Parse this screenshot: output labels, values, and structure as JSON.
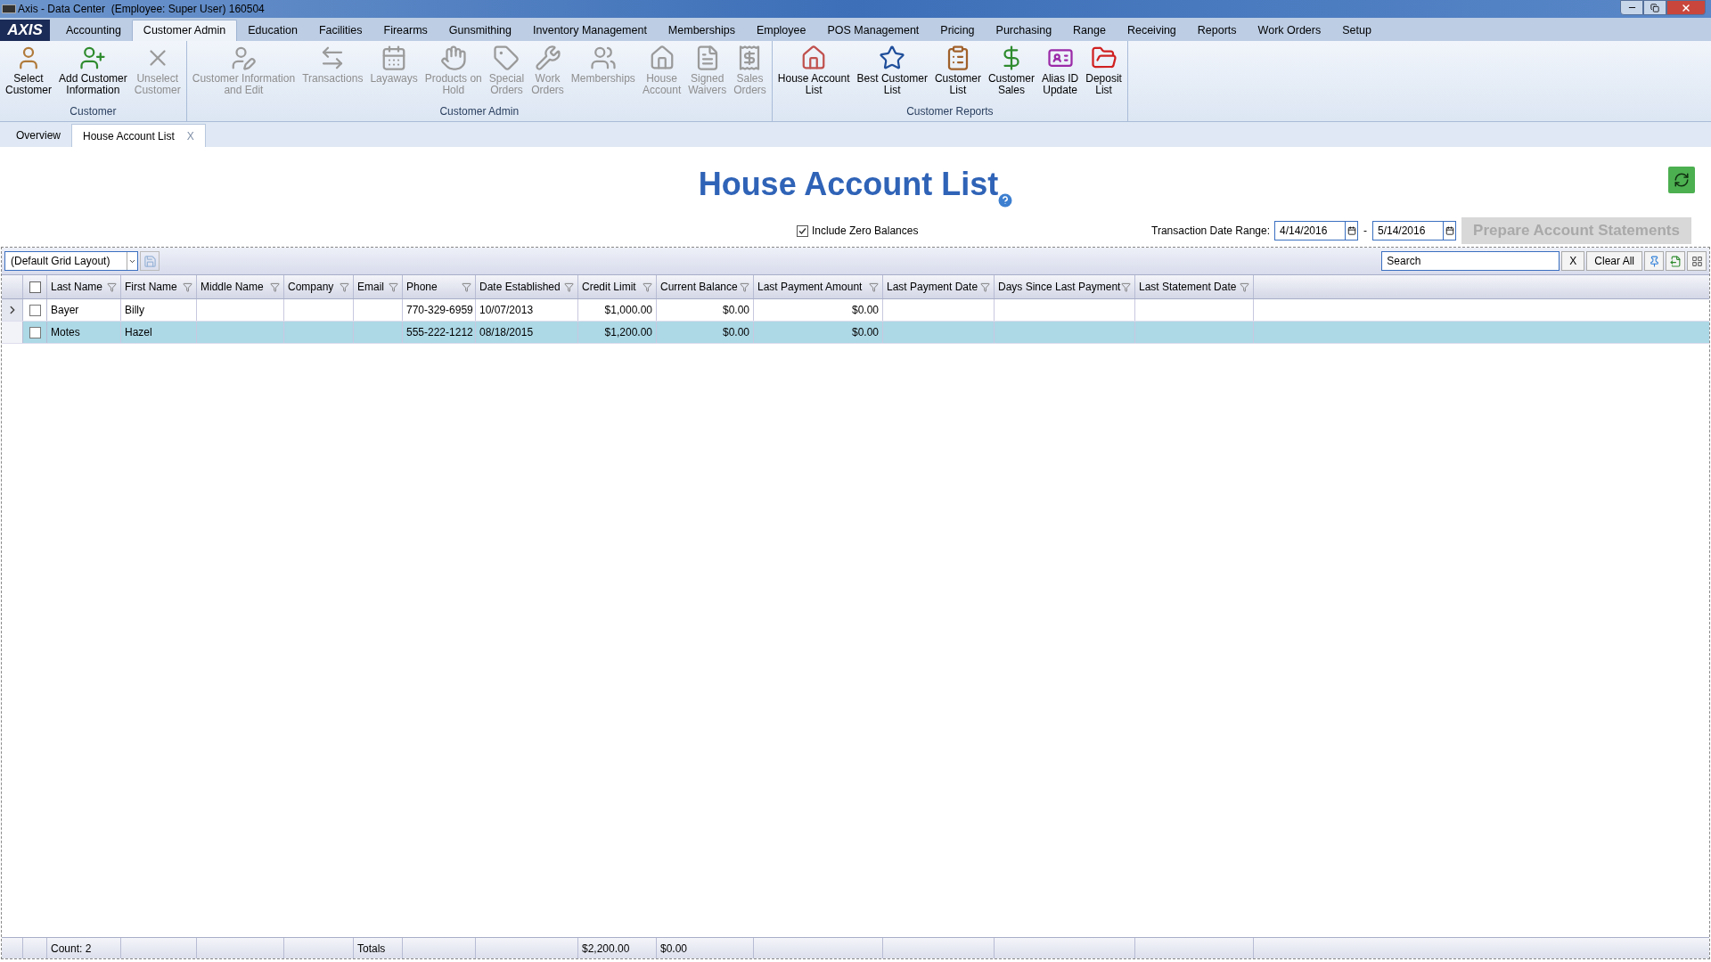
{
  "window": {
    "title": "Axis - Data Center  (Employee: Super User) 160504"
  },
  "logo": "AXIS",
  "menu_tabs": [
    {
      "label": "Accounting",
      "selected": false
    },
    {
      "label": "Customer Admin",
      "selected": true
    },
    {
      "label": "Education",
      "selected": false
    },
    {
      "label": "Facilities",
      "selected": false
    },
    {
      "label": "Firearms",
      "selected": false
    },
    {
      "label": "Gunsmithing",
      "selected": false
    },
    {
      "label": "Inventory Management",
      "selected": false
    },
    {
      "label": "Memberships",
      "selected": false
    },
    {
      "label": "Employee",
      "selected": false
    },
    {
      "label": "POS Management",
      "selected": false
    },
    {
      "label": "Pricing",
      "selected": false
    },
    {
      "label": "Purchasing",
      "selected": false
    },
    {
      "label": "Range",
      "selected": false
    },
    {
      "label": "Receiving",
      "selected": false
    },
    {
      "label": "Reports",
      "selected": false
    },
    {
      "label": "Work Orders",
      "selected": false
    },
    {
      "label": "Setup",
      "selected": false
    }
  ],
  "ribbon_groups": [
    {
      "label": "Customer",
      "items": [
        {
          "label": "Select\nCustomer",
          "disabled": false
        },
        {
          "label": "Add Customer\nInformation",
          "disabled": false
        },
        {
          "label": "Unselect\nCustomer",
          "disabled": true
        }
      ]
    },
    {
      "label": "Customer Admin",
      "items": [
        {
          "label": "Customer Information\nand Edit",
          "disabled": true
        },
        {
          "label": "Transactions",
          "disabled": true
        },
        {
          "label": "Layaways",
          "disabled": true
        },
        {
          "label": "Products on\nHold",
          "disabled": true
        },
        {
          "label": "Special\nOrders",
          "disabled": true
        },
        {
          "label": "Work\nOrders",
          "disabled": true
        },
        {
          "label": "Memberships",
          "disabled": true
        },
        {
          "label": "House\nAccount",
          "disabled": true
        },
        {
          "label": "Signed\nWaivers",
          "disabled": true
        },
        {
          "label": "Sales\nOrders",
          "disabled": true
        }
      ]
    },
    {
      "label": "Customer Reports",
      "items": [
        {
          "label": "House Account\nList",
          "disabled": false
        },
        {
          "label": "Best Customer\nList",
          "disabled": false
        },
        {
          "label": "Customer\nList",
          "disabled": false
        },
        {
          "label": "Customer\nSales",
          "disabled": false
        },
        {
          "label": "Alias ID\nUpdate",
          "disabled": false
        },
        {
          "label": "Deposit\nList",
          "disabled": false
        }
      ]
    }
  ],
  "doc_tabs": [
    {
      "label": "Overview",
      "selected": false
    },
    {
      "label": "House Account List",
      "selected": true,
      "close": "X"
    }
  ],
  "page": {
    "title": "House Account List",
    "include_zero_balances": {
      "label": "Include Zero Balances",
      "checked": true
    },
    "date_range": {
      "label": "Transaction Date Range:",
      "from": "4/14/2016",
      "separator": "-",
      "to": "5/14/2016"
    },
    "prepare_button": {
      "label": "Prepare Account Statements",
      "disabled": true
    }
  },
  "grid": {
    "layout": "(Default Grid Layout)",
    "search": {
      "placeholder": "Search"
    },
    "clear_x": "X",
    "clear_all": "Clear All",
    "header_checked": false,
    "columns": [
      {
        "label": "Last Name",
        "footer": "Count: 2"
      },
      {
        "label": "First Name"
      },
      {
        "label": "Middle Name"
      },
      {
        "label": "Company"
      },
      {
        "label": "Email",
        "footer": "Totals"
      },
      {
        "label": "Phone"
      },
      {
        "label": "Date Established"
      },
      {
        "label": "Credit Limit",
        "footer": "$2,200.00"
      },
      {
        "label": "Current Balance",
        "footer": "$0.00"
      },
      {
        "label": "Last Payment Amount"
      },
      {
        "label": "Last Payment Date"
      },
      {
        "label": "Days Since Last Payment"
      },
      {
        "label": "Last Statement Date"
      }
    ],
    "rows": [
      {
        "current": true,
        "selected": false,
        "checked": false,
        "cells": [
          "Bayer",
          "Billy",
          "",
          "",
          "",
          "770-329-6959",
          "10/07/2013",
          "$1,000.00",
          "$0.00",
          "$0.00",
          "",
          "",
          ""
        ]
      },
      {
        "current": false,
        "selected": true,
        "checked": false,
        "cells": [
          "Motes",
          "Hazel",
          "",
          "",
          "",
          "555-222-1212",
          "08/18/2015",
          "$1,200.00",
          "$0.00",
          "$0.00",
          "",
          "",
          ""
        ]
      }
    ]
  }
}
